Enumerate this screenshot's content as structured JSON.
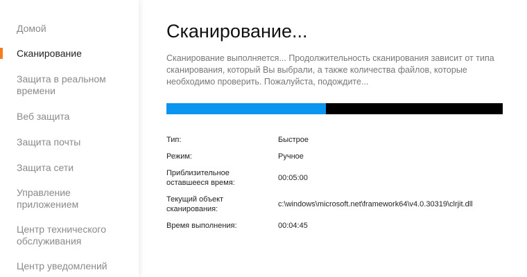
{
  "sidebar": {
    "items": [
      {
        "label": "Домой"
      },
      {
        "label": "Сканирование"
      },
      {
        "label": "Защита в реальном времени"
      },
      {
        "label": "Веб защита"
      },
      {
        "label": "Защита почты"
      },
      {
        "label": "Защита сети"
      },
      {
        "label": "Управление приложением"
      },
      {
        "label": "Центр технического обслуживания"
      },
      {
        "label": "Центр уведомлений"
      }
    ],
    "active_index": 1,
    "accent_color": "#f47d20"
  },
  "main": {
    "title": "Сканирование...",
    "description": "Сканирование выполняется... Продолжительность сканирования зависит от типа сканирования, который Вы выбрали, а также количества файлов, которые необходимо проверить. Пожалуйста, подождите...",
    "progress": {
      "fraction": 0.475,
      "fill_color": "#0a96f0",
      "track_color": "#000000"
    },
    "info": [
      {
        "label": "Тип:",
        "value": "Быстрое"
      },
      {
        "label": "Режим:",
        "value": "Ручное"
      },
      {
        "label": "Приблизительное оставшееся время:",
        "value": "00:05:00"
      },
      {
        "label": "Текущий объект сканирования:",
        "value": "c:\\windows\\microsoft.net\\framework64\\v4.0.30319\\clrjit.dll"
      },
      {
        "label": "Время выполнения:",
        "value": "00:04:45"
      }
    ]
  }
}
